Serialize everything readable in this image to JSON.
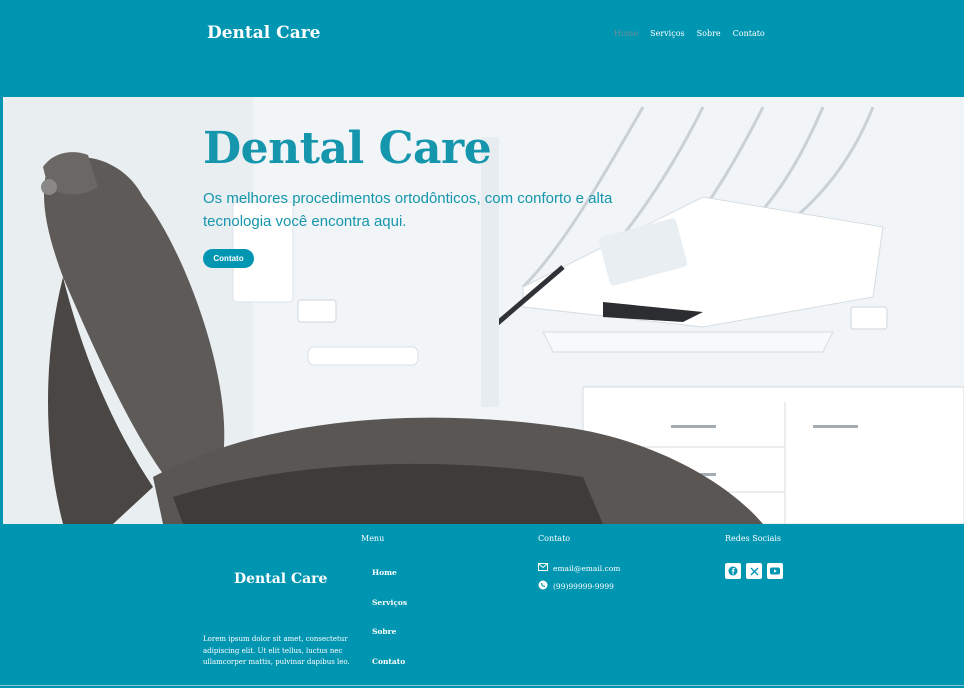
{
  "header": {
    "logo": "Dental Care",
    "nav": [
      "Home",
      "Serviços",
      "Sobre",
      "Contato"
    ],
    "active_nav": "Home"
  },
  "hero": {
    "title": "Dental Care",
    "subtitle": "Os melhores procedimentos ortodônticos, com conforto e alta tecnologia você encontra aqui.",
    "button": "Contato"
  },
  "footer": {
    "logo": "Dental Care",
    "about": "Lorem ipsum dolor sit amet, consectetur adipiscing elit. Ut elit tellus, luctus nec ullamcorper mattis, pulvinar dapibus leo.",
    "menu_heading": "Menu",
    "menu_items": [
      "Home",
      "Serviços",
      "Sobre",
      "Contato"
    ],
    "contact_heading": "Contato",
    "email": "email@email.com",
    "phone": "(99)99999-9999",
    "social_heading": "Redes Sociais",
    "social_icons": [
      "facebook-icon",
      "x-icon",
      "youtube-icon"
    ]
  },
  "colors": {
    "brand": "#0096b2",
    "hero_text": "#1596ad",
    "chair": "#5e5a58"
  }
}
